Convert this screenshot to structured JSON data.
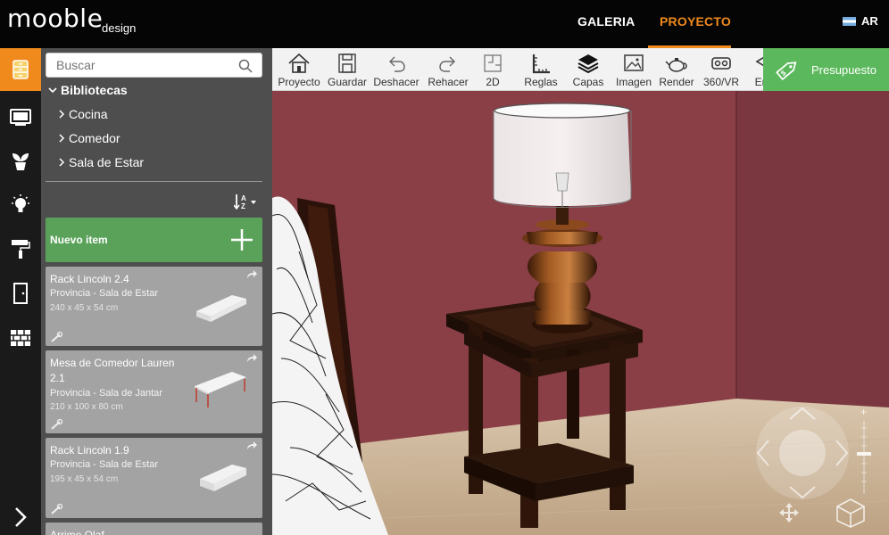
{
  "app": {
    "logo": "mooble",
    "logo_sub": "design"
  },
  "nav": {
    "galeria": "GALERIA",
    "proyecto": "PROYECTO",
    "region": "AR"
  },
  "rail": {
    "items": [
      {
        "icon": "drawers-icon",
        "active": true
      },
      {
        "icon": "tv-icon",
        "active": false
      },
      {
        "icon": "plant-icon",
        "active": false
      },
      {
        "icon": "lightbulb-icon",
        "active": false
      },
      {
        "icon": "paint-roller-icon",
        "active": false
      },
      {
        "icon": "door-icon",
        "active": false
      },
      {
        "icon": "brick-wall-icon",
        "active": false
      }
    ]
  },
  "library": {
    "search_placeholder": "Buscar",
    "root": "Bibliotecas",
    "categories": [
      "Cocina",
      "Comedor",
      "Sala de Estar"
    ],
    "new_item_label": "Nuevo item",
    "cards": [
      {
        "title": "Rack Lincoln 2.4",
        "subtitle": "Provincia - Sala de Estar",
        "dims": "240 x 45 x 54 cm"
      },
      {
        "title": "Mesa de Comedor Lauren 2.1",
        "subtitle": "Provincia - Sala de Jantar",
        "dims": "210 x 100 x 80 cm"
      },
      {
        "title": "Rack Lincoln 1.9",
        "subtitle": "Provincia - Sala de Estar",
        "dims": "195 x 45 x 54 cm"
      },
      {
        "title": "Arrimo Olaf",
        "subtitle": "",
        "dims": ""
      }
    ]
  },
  "toolbar": {
    "proyecto": "Proyecto",
    "guardar": "Guardar",
    "deshacer": "Deshacer",
    "rehacer": "Rehacer",
    "2d": "2D",
    "reglas": "Reglas",
    "capas": "Capas",
    "imagen": "Imagen",
    "render": "Render",
    "vr": "360/VR",
    "en": "En"
  },
  "budget": {
    "label": "Presupuesto"
  },
  "colors": {
    "accent": "#f08a1c",
    "green": "#5cb85c",
    "wall": "#8a3f47",
    "panel": "#4e4e4e"
  }
}
